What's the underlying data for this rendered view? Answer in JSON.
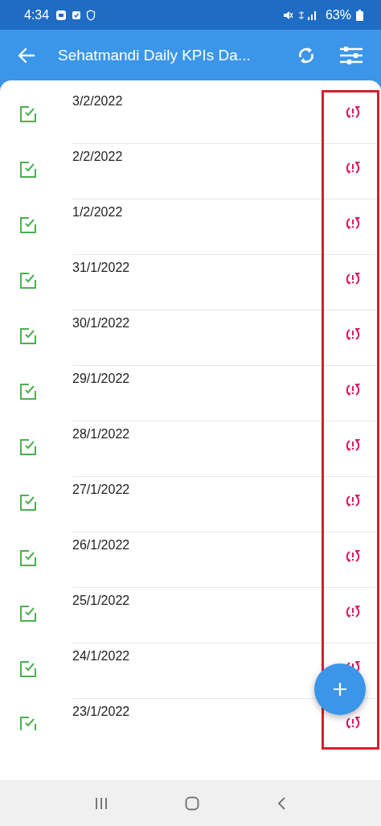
{
  "status_bar": {
    "time": "4:34",
    "battery": "63%"
  },
  "app_bar": {
    "title": "Sehatmandi Daily KPIs Da..."
  },
  "records": [
    {
      "date": "3/2/2022",
      "complete": true,
      "synced": false
    },
    {
      "date": "2/2/2022",
      "complete": true,
      "synced": false
    },
    {
      "date": "1/2/2022",
      "complete": true,
      "synced": false
    },
    {
      "date": "31/1/2022",
      "complete": true,
      "synced": false
    },
    {
      "date": "30/1/2022",
      "complete": true,
      "synced": false
    },
    {
      "date": "29/1/2022",
      "complete": true,
      "synced": false
    },
    {
      "date": "28/1/2022",
      "complete": true,
      "synced": false
    },
    {
      "date": "27/1/2022",
      "complete": true,
      "synced": false
    },
    {
      "date": "26/1/2022",
      "complete": true,
      "synced": false
    },
    {
      "date": "25/1/2022",
      "complete": true,
      "synced": false
    },
    {
      "date": "24/1/2022",
      "complete": true,
      "synced": false
    },
    {
      "date": "23/1/2022",
      "complete": true,
      "synced": false
    }
  ]
}
